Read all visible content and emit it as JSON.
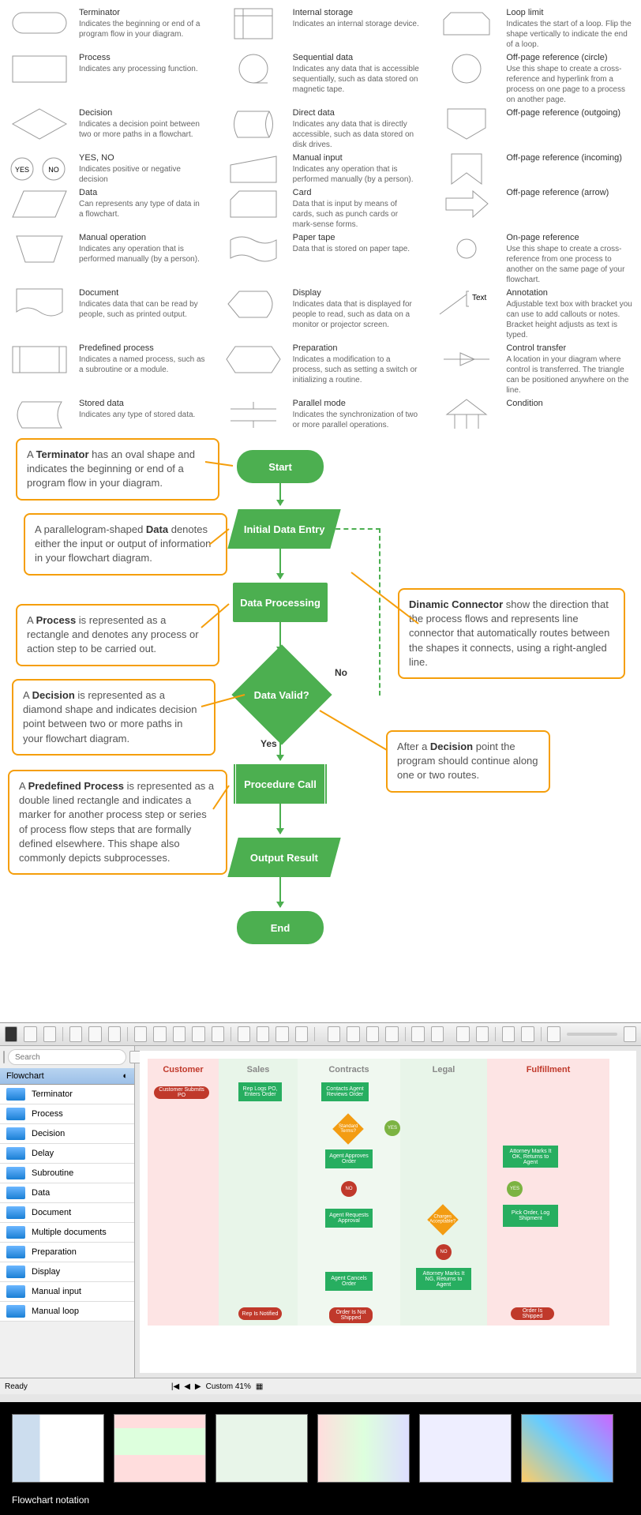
{
  "symbols": [
    {
      "title": "Terminator",
      "desc": "Indicates the beginning or end of a program flow in your diagram."
    },
    {
      "title": "Internal storage",
      "desc": "Indicates an internal storage device."
    },
    {
      "title": "Loop limit",
      "desc": "Indicates the start of a loop. Flip the shape vertically to indicate the end of a loop."
    },
    {
      "title": "Process",
      "desc": "Indicates any processing function."
    },
    {
      "title": "Sequential data",
      "desc": "Indicates any data that is accessible sequentially, such as data stored on magnetic tape."
    },
    {
      "title": "Off-page reference (circle)",
      "desc": "Use this shape to create a cross-reference and hyperlink from a process on one page to a process on another page."
    },
    {
      "title": "Decision",
      "desc": "Indicates a decision point between two or more paths in a flowchart."
    },
    {
      "title": "Direct data",
      "desc": "Indicates any data that is directly accessible, such as data stored on disk drives."
    },
    {
      "title": "Off-page reference (outgoing)",
      "desc": ""
    },
    {
      "title": "YES, NO",
      "desc": "Indicates positive or negative decision"
    },
    {
      "title": "Manual input",
      "desc": "Indicates any operation that is performed manually (by a person)."
    },
    {
      "title": "Off-page reference (incoming)",
      "desc": ""
    },
    {
      "title": "Data",
      "desc": "Can represents any type of data in a flowchart."
    },
    {
      "title": "Card",
      "desc": "Data that is input by means of cards, such as punch cards or mark-sense forms."
    },
    {
      "title": "Off-page reference (arrow)",
      "desc": ""
    },
    {
      "title": "Manual operation",
      "desc": "Indicates any operation that is performed manually (by a person)."
    },
    {
      "title": "Paper tape",
      "desc": "Data that is stored on paper tape."
    },
    {
      "title": "On-page reference",
      "desc": "Use this shape to create a cross-reference from one process to another on the same page of your flowchart."
    },
    {
      "title": "Document",
      "desc": "Indicates data that can be read by people, such as printed output."
    },
    {
      "title": "Display",
      "desc": "Indicates data that is displayed for people to read, such as data on a monitor or projector screen."
    },
    {
      "title": "Annotation",
      "desc": "Adjustable text box with bracket you can use to add callouts or notes. Bracket height adjusts as text is typed."
    },
    {
      "title": "Predefined process",
      "desc": "Indicates a named process, such as a subroutine or a module."
    },
    {
      "title": "Preparation",
      "desc": "Indicates a modification to a process, such as setting a switch or initializing a routine."
    },
    {
      "title": "Control transfer",
      "desc": "A location in your diagram where control is transferred. The triangle can be positioned anywhere on the line."
    },
    {
      "title": "Stored data",
      "desc": "Indicates any type of stored data."
    },
    {
      "title": "Parallel mode",
      "desc": "Indicates the synchronization of two or more parallel operations."
    },
    {
      "title": "Condition",
      "desc": ""
    }
  ],
  "callouts": {
    "c1": "A <b>Terminator</b> has an oval shape and indicates the beginning or end of a program flow in your diagram.",
    "c2": "A parallelogram-shaped <b>Data</b> denotes either the input or output of information in your flowchart diagram.",
    "c3": "A <b>Process</b> is represented as a rectangle and denotes any process or action step to be carried out.",
    "c4": "A <b>Decision</b> is represented as a diamond shape and indicates decision point between two or more paths in your flowchart diagram.",
    "c5": "A <b>Predefined Process</b> is represented as a double lined rectangle and indicates a marker for another process step or series of process flow steps that are formally defined elsewhere. This shape also commonly depicts subprocesses.",
    "c6": "<b>Dinamic Connector</b> show the direction that the process flows and represents line connector that automatically routes between the shapes it connects, using a right-angled line.",
    "c7": "After a <b>Decision</b> point the program should continue along one or two routes."
  },
  "flow": {
    "start": "Start",
    "initial": "Initial Data Entry",
    "processing": "Data Processing",
    "valid": "Data Valid?",
    "proc": "Procedure Call",
    "output": "Output Result",
    "end": "End",
    "yes": "Yes",
    "no": "No"
  },
  "annotation_text": "Text",
  "yesno": {
    "yes": "YES",
    "no": "NO"
  },
  "toolbar_search": "Search",
  "sidebar_header": "Flowchart",
  "sidebar_items": [
    "Terminator",
    "Process",
    "Decision",
    "Delay",
    "Subroutine",
    "Data",
    "Document",
    "Multiple documents",
    "Preparation",
    "Display",
    "Manual input",
    "Manual loop"
  ],
  "lanes": [
    "Customer",
    "Sales",
    "Contracts",
    "Legal",
    "Fulfillment"
  ],
  "canvas": {
    "submit": "Customer Submits PO",
    "rep": "Rep Logs PO, Enters Order",
    "contacts": "Contacts Agent Reviews Order",
    "standard": "Standard Terms?",
    "approves": "Agent Approves Order",
    "attorney1": "Attorney Marks It OK, Returns to Agent",
    "requests": "Agent Requests Approval",
    "charges": "Charges Acceptable?",
    "pick": "Pick Order, Log Shipment",
    "cancels": "Agent Cancels Order",
    "attorney2": "Attorney Marks It NG, Returns to Agent",
    "notified": "Rep Is Notified",
    "notshipped": "Order Is Not Shipped",
    "shipped": "Order Is Shipped",
    "yes": "YES",
    "no": "NO"
  },
  "status": {
    "ready": "Ready",
    "zoom": "Custom 41%"
  },
  "gallery_caption": "Flowchart notation"
}
